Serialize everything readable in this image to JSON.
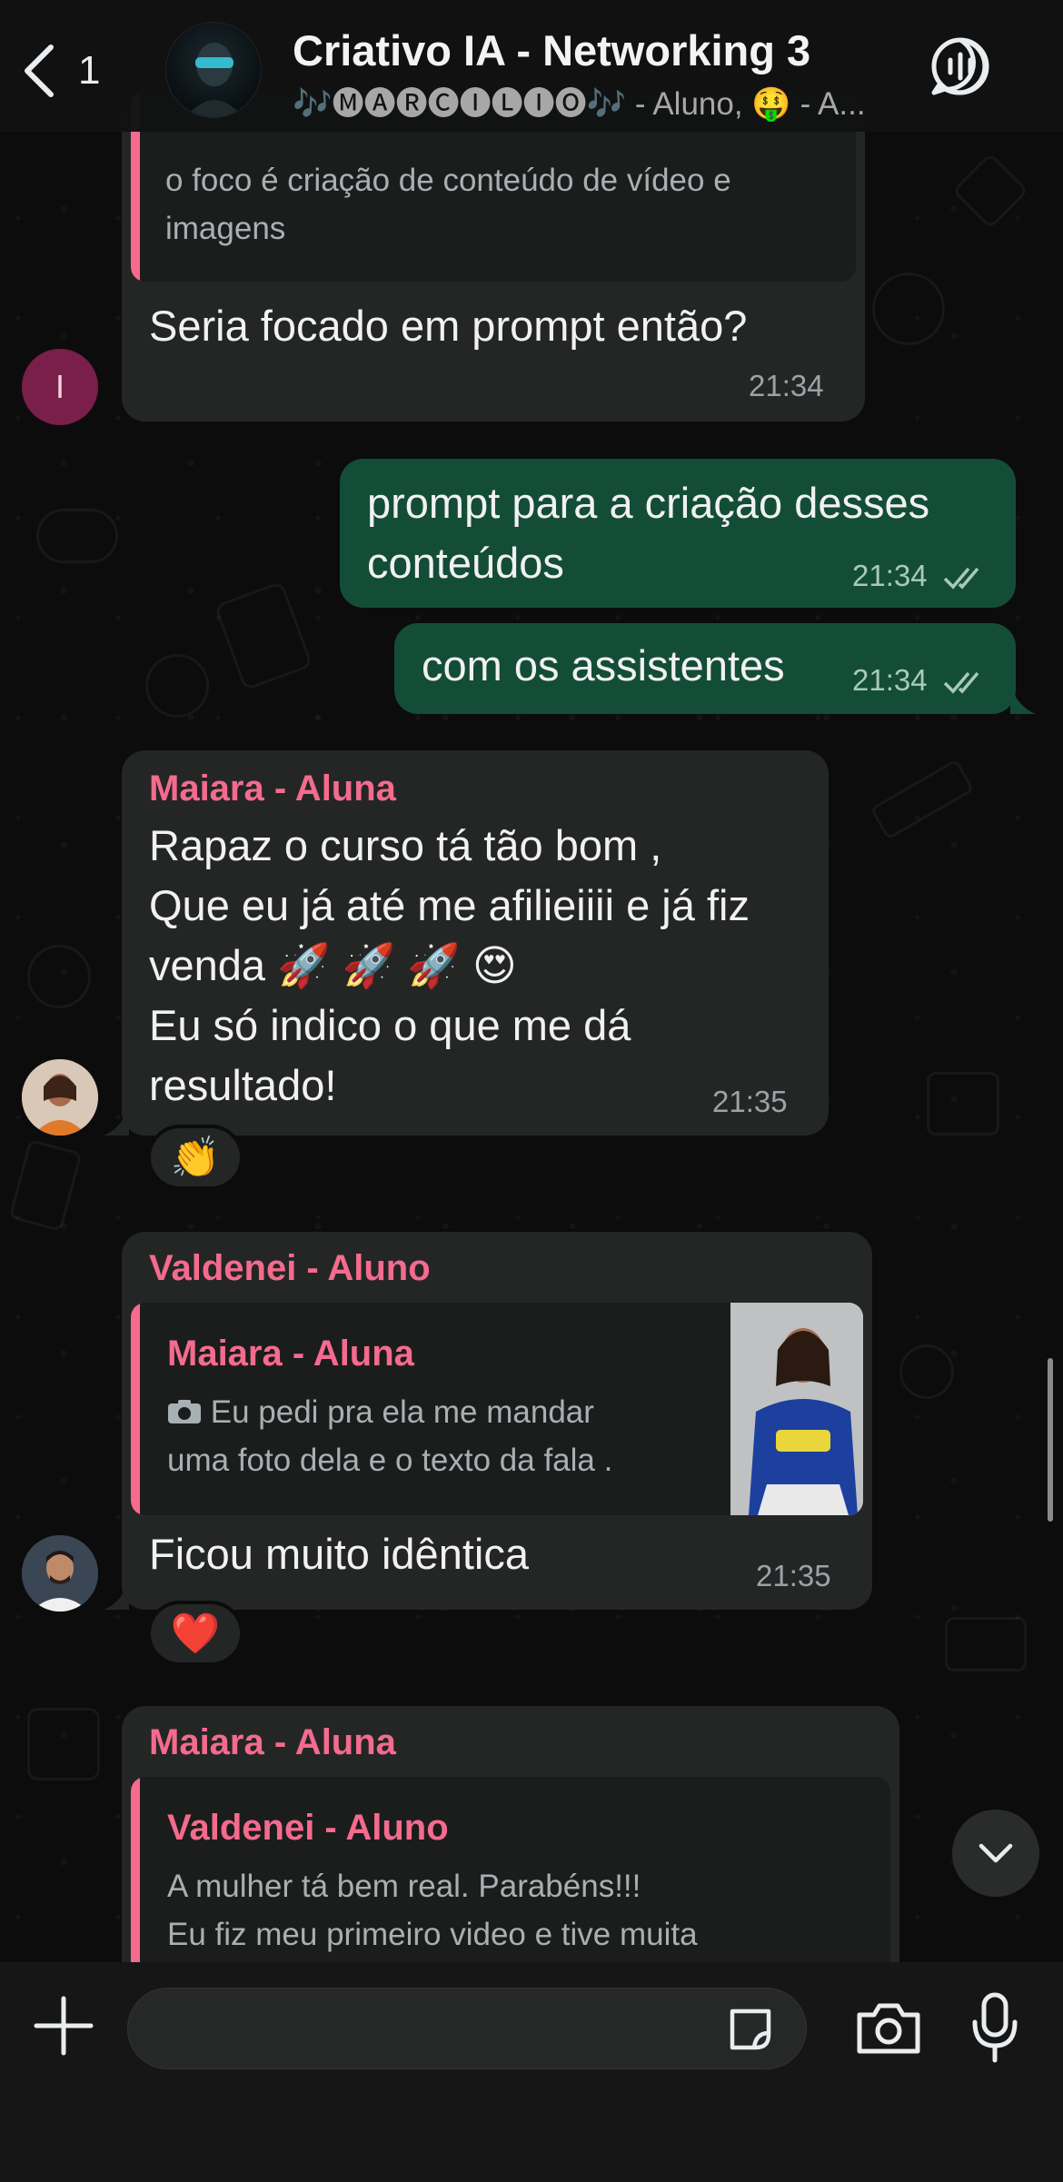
{
  "header": {
    "back_count": "1",
    "title": "Criativo IA - Networking 3",
    "subtitle": "🎶🅜🅐🅡🅒🅘🅛🅘🅞🎶 - Aluno, 🤑 - A..."
  },
  "messages": [
    {
      "partial_quote_text": "o foco é criação de conteúdo de vídeo e imagens",
      "text": "Seria focado em prompt então?",
      "time": "21:34",
      "avatar_letter": "I"
    },
    {
      "text": "prompt para a criação desses conteúdos",
      "time": "21:34"
    },
    {
      "text": "com os assistentes",
      "time": "21:34"
    },
    {
      "sender": "Maiara - Aluna",
      "lines": [
        "Rapaz o curso tá tão bom ,",
        "Que eu já até me afilieiiii e já fiz",
        "venda 🚀 🚀 🚀 😍",
        "Eu só indico o que me dá",
        "resultado!"
      ],
      "time": "21:35",
      "reaction": "👏"
    },
    {
      "sender": "Valdenei - Aluno",
      "quote_name": "Maiara - Aluna",
      "quote_lines": [
        "Eu pedi pra ela me mandar",
        "uma foto dela e o texto da fala ."
      ],
      "text": "Ficou muito idêntica",
      "time": "21:35",
      "reaction": "❤️"
    },
    {
      "sender": "Maiara - Aluna",
      "quote_name": "Valdenei - Aluno",
      "quote_lines": [
        "A mulher tá bem real. Parabéns!!!",
        "Eu fiz meu primeiro video e tive muita"
      ]
    }
  ],
  "colors": {
    "incoming_bubble": "#242626",
    "outgoing_bubble": "#144d37",
    "sender_name": "#f46b8d"
  }
}
